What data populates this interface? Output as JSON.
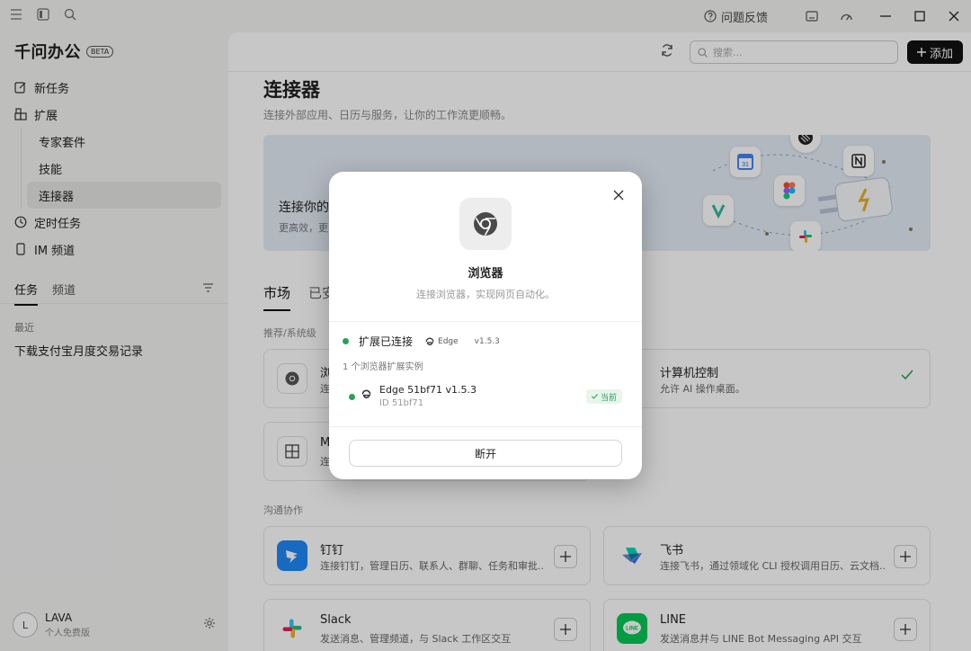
{
  "titlebar": {
    "feedback": "问题反馈"
  },
  "sidebar": {
    "brand": "千问办公",
    "beta": "BETA",
    "nav": {
      "new_task": "新任务",
      "extensions": "扩展",
      "expert_kits": "专家套件",
      "skills": "技能",
      "connectors": "连接器",
      "scheduled": "定时任务",
      "im": "IM 频道"
    },
    "tabs": [
      "任务",
      "频道"
    ],
    "recent_label": "最近",
    "recent_items": [
      "下载支付宝月度交易记录"
    ],
    "user": {
      "name": "LAVA",
      "plan": "个人免费版",
      "initial": "L"
    }
  },
  "main": {
    "search_placeholder": "搜索...",
    "add_label": "添加",
    "title": "连接器",
    "subtitle": "连接外部应用、日历与服务，让你的工作流更顺畅。",
    "banner": {
      "title": "连接你的",
      "sub": "更高效，更"
    },
    "tabs": [
      "市场",
      "已安"
    ],
    "section1": "推荐/系统级",
    "section2": "沟通协作",
    "cards": {
      "browser": {
        "name": "浏",
        "desc": "连"
      },
      "computer": {
        "name": "计算机控制",
        "desc": "允许 AI 操作桌面。"
      },
      "m": {
        "name": "M",
        "desc": "连"
      },
      "dingtalk": {
        "name": "钉钉",
        "desc": "连接钉钉，管理日历、联系人、群聊、任务和审批..."
      },
      "feishu": {
        "name": "飞书",
        "desc": "连接飞书，通过领域化 CLI 授权调用日历、云文档..."
      },
      "slack": {
        "name": "Slack",
        "desc": "发送消息、管理频道，与 Slack 工作区交互"
      },
      "line": {
        "name": "LINE",
        "desc": "发送消息并与 LINE Bot Messaging API 交互"
      }
    }
  },
  "modal": {
    "title": "浏览器",
    "subtitle": "连接浏览器，实现网页自动化。",
    "status": "扩展已连接",
    "browser_tag": "Edge",
    "version": "v1.5.3",
    "instances_label": "1 个浏览器扩展实例",
    "instance": {
      "name": "Edge 51bf71 v1.5.3",
      "id": "ID 51bf71",
      "badge": "当前"
    },
    "disconnect": "断开"
  },
  "colors": {
    "accent": "#111111",
    "connected": "#2f9e58",
    "banner_bg": "#e4ecf6"
  }
}
